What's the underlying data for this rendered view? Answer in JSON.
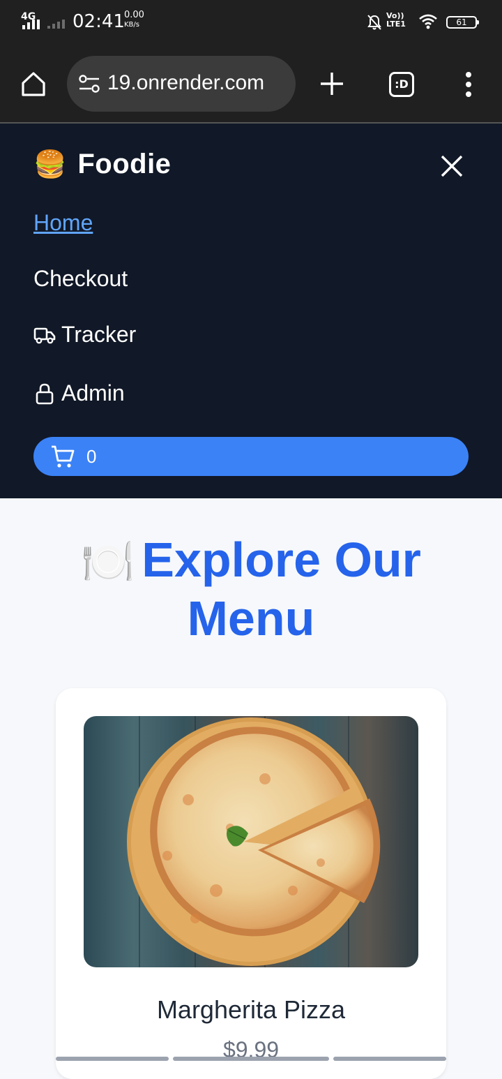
{
  "status_bar": {
    "network": "4G",
    "time": "02:41",
    "speed_value": "0.00",
    "speed_unit": "KB/s",
    "volte_top": "Vo))",
    "volte_bottom": "LTE1",
    "battery": "61"
  },
  "browser": {
    "url": "19.onrender.com",
    "tabs_label": ":D"
  },
  "nav": {
    "brand_emoji": "🍔",
    "brand_name": "Foodie",
    "links": [
      {
        "label": "Home"
      },
      {
        "label": "Checkout"
      },
      {
        "label": "Tracker"
      },
      {
        "label": "Admin"
      }
    ],
    "cart_count": "0"
  },
  "main": {
    "heading_emoji": "🍽️",
    "heading_line1": "Explore Our",
    "heading_line2": "Menu"
  },
  "menu_items": [
    {
      "name": "Margherita Pizza",
      "price": "$9.99"
    }
  ],
  "colors": {
    "nav_bg": "#111827",
    "accent": "#3b82f6",
    "heading": "#2563eb",
    "active_link": "#60a5fa"
  }
}
